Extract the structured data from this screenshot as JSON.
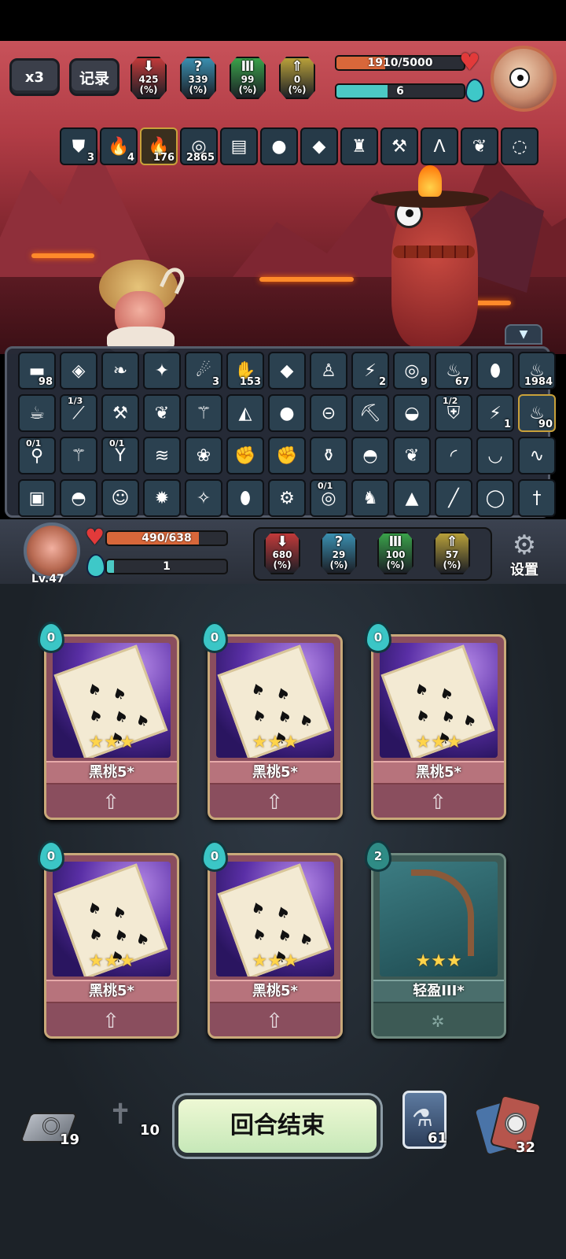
{
  "top_left": {
    "speed_label": "x3",
    "log_label": "记录"
  },
  "enemy": {
    "stats": [
      {
        "value": "425",
        "unit": "(%)",
        "icon": "attack-arrow-icon",
        "color": "#c23a3a"
      },
      {
        "value": "339",
        "unit": "(%)",
        "icon": "question-icon",
        "color": "#3a8fb0"
      },
      {
        "value": "99",
        "unit": "(%)",
        "icon": "shield-bars-icon",
        "color": "#3aa24a"
      },
      {
        "value": "0",
        "unit": "(%)",
        "icon": "up-arrow-icon",
        "color": "#b8a03a"
      }
    ],
    "hp_text": "1910/5000",
    "hp_fraction": 0.382,
    "energy_text": "6",
    "energy_fraction": 0.4
  },
  "enemy_buffs": [
    {
      "icon": "shield-icon",
      "count": "3"
    },
    {
      "icon": "flame-icon",
      "count": "4"
    },
    {
      "icon": "gold-flame-icon",
      "count": "176"
    },
    {
      "icon": "vortex-icon",
      "count": "2865"
    },
    {
      "icon": "book-icon",
      "count": ""
    },
    {
      "icon": "green-slime-icon",
      "count": ""
    },
    {
      "icon": "green-gem-icon",
      "count": ""
    },
    {
      "icon": "armor-figure-icon",
      "count": ""
    },
    {
      "icon": "torch-icon",
      "count": ""
    },
    {
      "icon": "claw-icon",
      "count": ""
    },
    {
      "icon": "wing-icon",
      "count": ""
    },
    {
      "icon": "prayer-beads-icon",
      "count": ""
    }
  ],
  "relics": [
    {
      "icon": "green-beam-icon",
      "count": "98"
    },
    {
      "icon": "water-drop-icon",
      "count": ""
    },
    {
      "icon": "leaf-blade-icon",
      "count": ""
    },
    {
      "icon": "crystal-orb-icon",
      "count": ""
    },
    {
      "icon": "fire-meteor-icon",
      "count": "3"
    },
    {
      "icon": "green-hand-icon",
      "count": "153"
    },
    {
      "icon": "green-leaf-icon",
      "count": ""
    },
    {
      "icon": "spirit-figure-icon",
      "count": ""
    },
    {
      "icon": "lightning-icon",
      "count": "2"
    },
    {
      "icon": "vortex-icon",
      "count": "9"
    },
    {
      "icon": "fire-spirit-icon",
      "count": "67"
    },
    {
      "icon": "dragon-egg-icon",
      "count": ""
    },
    {
      "icon": "fire-shadow-icon",
      "count": "1984"
    },
    {
      "icon": "tea-cup-icon",
      "count": ""
    },
    {
      "icon": "scroll-icon",
      "count": "",
      "top": "1/3"
    },
    {
      "icon": "hammer-icon",
      "count": ""
    },
    {
      "icon": "feather-wings-icon",
      "count": ""
    },
    {
      "icon": "fire-staff-icon",
      "count": ""
    },
    {
      "icon": "fox-mask-icon",
      "count": ""
    },
    {
      "icon": "green-slime-icon",
      "count": ""
    },
    {
      "icon": "goggles-icon",
      "count": ""
    },
    {
      "icon": "pickaxe-icon",
      "count": ""
    },
    {
      "icon": "pot-icon",
      "count": ""
    },
    {
      "icon": "armor-icon",
      "count": "",
      "top": "1/2"
    },
    {
      "icon": "lightning-fist-icon",
      "count": "1"
    },
    {
      "icon": "candle-flame-icon",
      "count": "90"
    },
    {
      "icon": "pacifier-icon",
      "count": "",
      "top": "0/1"
    },
    {
      "icon": "fire-wand-icon",
      "count": ""
    },
    {
      "icon": "slingshot-icon",
      "count": "",
      "top": "0/1"
    },
    {
      "icon": "wind-icon",
      "count": ""
    },
    {
      "icon": "herb-icon",
      "count": ""
    },
    {
      "icon": "glove-icon",
      "count": ""
    },
    {
      "icon": "gauntlet-icon",
      "count": ""
    },
    {
      "icon": "potion-bag-icon",
      "count": ""
    },
    {
      "icon": "helmet-icon",
      "count": ""
    },
    {
      "icon": "bird-icon",
      "count": ""
    },
    {
      "icon": "horn-icon",
      "count": ""
    },
    {
      "icon": "banana-icon",
      "count": ""
    },
    {
      "icon": "rope-icon",
      "count": ""
    },
    {
      "icon": "scroll-card-icon",
      "count": ""
    },
    {
      "icon": "green-helmet-icon",
      "count": ""
    },
    {
      "icon": "mask-icon",
      "count": ""
    },
    {
      "icon": "spiked-ball-icon",
      "count": ""
    },
    {
      "icon": "sparkle-cone-icon",
      "count": ""
    },
    {
      "icon": "egg-icon",
      "count": ""
    },
    {
      "icon": "gear-cookie-icon",
      "count": ""
    },
    {
      "icon": "galaxy-icon",
      "count": "",
      "top": "0/1"
    },
    {
      "icon": "red-creature-icon",
      "count": ""
    },
    {
      "icon": "hay-stack-icon",
      "count": ""
    },
    {
      "icon": "red-stick-icon",
      "count": ""
    },
    {
      "icon": "rainbow-ring-icon",
      "count": ""
    },
    {
      "icon": "dagger-icon",
      "count": ""
    }
  ],
  "player": {
    "level": "Lv.47",
    "hp_text": "490/638",
    "hp_fraction": 0.768,
    "energy_text": "1",
    "energy_fraction": 0.06,
    "stats": [
      {
        "value": "680",
        "unit": "(%)",
        "icon": "attack-arrow-icon",
        "color": "#c23a3a"
      },
      {
        "value": "29",
        "unit": "(%)",
        "icon": "question-icon",
        "color": "#3a8fb0"
      },
      {
        "value": "100",
        "unit": "(%)",
        "icon": "shield-bars-icon",
        "color": "#3aa24a"
      },
      {
        "value": "57",
        "unit": "(%)",
        "icon": "up-arrow-icon",
        "color": "#b8a03a"
      }
    ],
    "settings_label": "设置"
  },
  "hand": [
    {
      "cost": "0",
      "name": "黑桃5*",
      "stars": "★★★",
      "type": "spade"
    },
    {
      "cost": "0",
      "name": "黑桃5*",
      "stars": "★★★",
      "type": "spade"
    },
    {
      "cost": "0",
      "name": "黑桃5*",
      "stars": "★★★",
      "type": "spade"
    },
    {
      "cost": "0",
      "name": "黑桃5*",
      "stars": "★★★",
      "type": "spade"
    },
    {
      "cost": "0",
      "name": "黑桃5*",
      "stars": "★★★",
      "type": "spade"
    },
    {
      "cost": "2",
      "name": "轻盈III*",
      "stars": "★★★",
      "type": "light"
    }
  ],
  "bottom": {
    "draw_pile": "19",
    "grave_pile": "10",
    "end_turn_label": "回合结束",
    "potion_count": "61",
    "discard_pile": "32"
  }
}
